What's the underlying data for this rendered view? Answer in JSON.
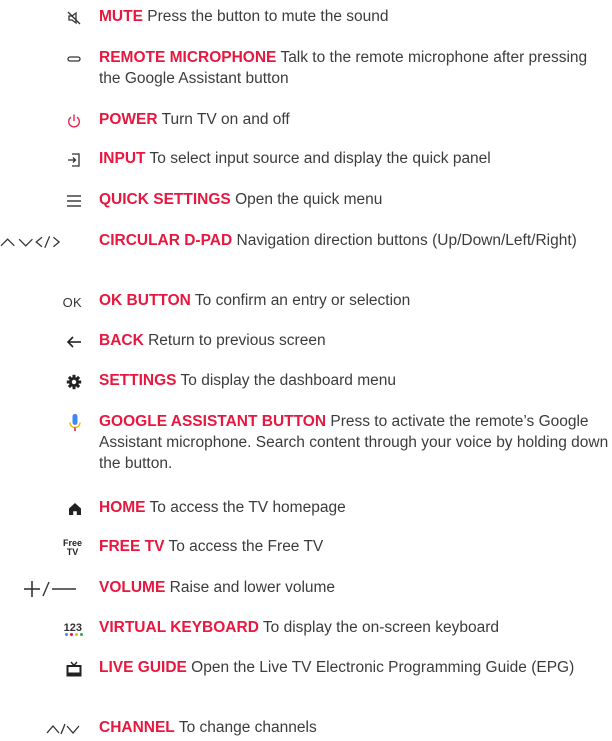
{
  "items": [
    {
      "label": "MUTE",
      "desc": "Press the button to mute the sound"
    },
    {
      "label": "REMOTE MICROPHONE",
      "desc": "Talk to the remote microphone after pressing the Google Assistant button"
    },
    {
      "label": "POWER",
      "desc": "Turn TV on and off"
    },
    {
      "label": "INPUT",
      "desc": "To select input source and display the quick panel"
    },
    {
      "label": "QUICK SETTINGS",
      "desc": "Open the quick menu"
    },
    {
      "label": "CIRCULAR D-PAD",
      "desc": "Navigation direction buttons (Up/Down/Left/Right)"
    },
    {
      "label": "OK BUTTON",
      "desc": "To confirm an entry or selection"
    },
    {
      "label": "BACK",
      "desc": "Return to previous screen"
    },
    {
      "label": "SETTINGS",
      "desc": "To display the dashboard menu"
    },
    {
      "label": "GOOGLE ASSISTANT BUTTON",
      "desc": "Press to activate the remote’s Google Assistant microphone. Search content through your voice by holding down the button."
    },
    {
      "label": "HOME",
      "desc": "To access the TV homepage"
    },
    {
      "label": "FREE TV",
      "desc": "To access the Free TV"
    },
    {
      "label": "VOLUME",
      "desc": "Raise and lower volume"
    },
    {
      "label": "VIRTUAL KEYBOARD",
      "desc": "To display the on-screen keyboard"
    },
    {
      "label": "LIVE GUIDE",
      "desc": "Open the Live TV Electronic Programming Guide (EPG)"
    },
    {
      "label": "CHANNEL",
      "desc": "To change channels"
    }
  ],
  "icons": {
    "ok_text": "OK",
    "free_text_1": "Free",
    "free_text_2": "TV",
    "keyboard_text": "123"
  },
  "colors": {
    "label": "#e8173f",
    "text": "#3c3c3c",
    "power": "#e8173f",
    "mic": "#4285f4"
  }
}
